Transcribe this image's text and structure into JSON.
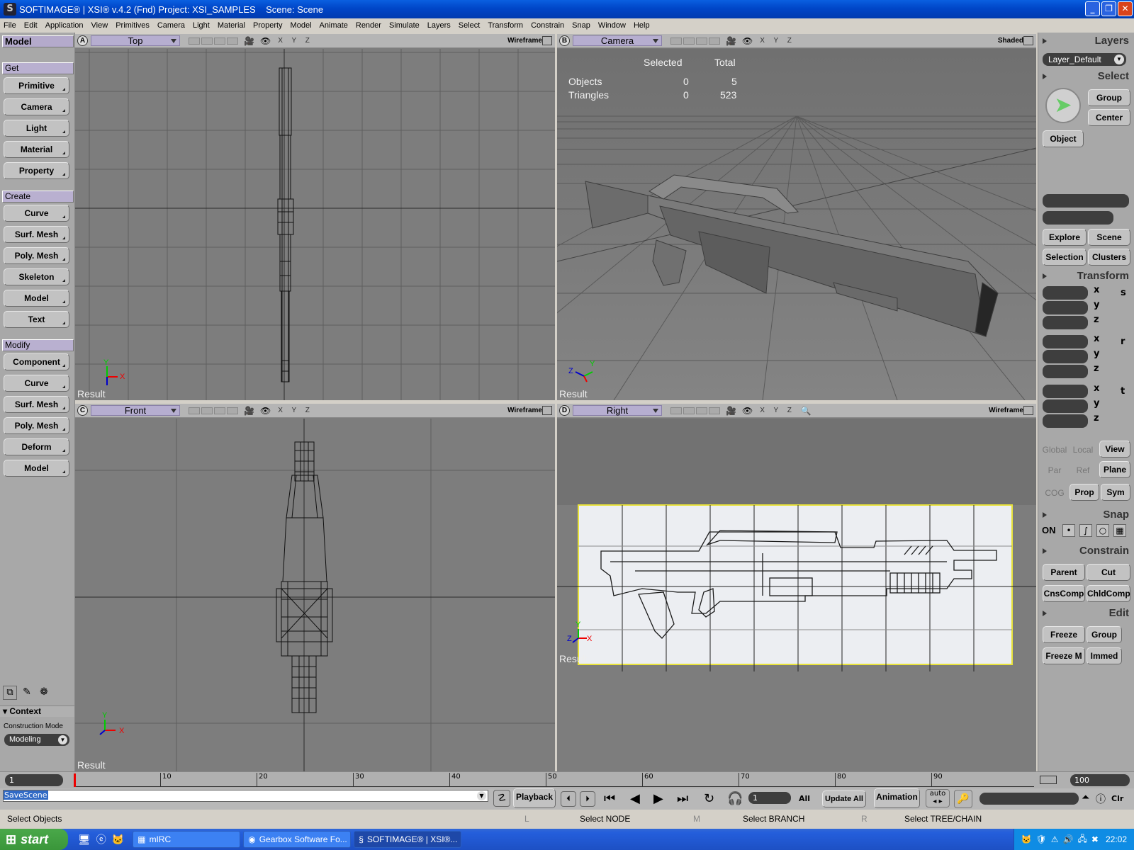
{
  "window": {
    "title": "SOFTIMAGE® | XSI® v.4.2 (Fnd) Project: XSI_SAMPLES    Scene: Scene",
    "logo": "S"
  },
  "menu": [
    "File",
    "Edit",
    "Application",
    "View",
    "Primitives",
    "Camera",
    "Light",
    "Material",
    "Property",
    "Model",
    "Animate",
    "Render",
    "Simulate",
    "Layers",
    "Select",
    "Transform",
    "Constrain",
    "Snap",
    "Window",
    "Help"
  ],
  "left": {
    "title": "Model",
    "get": {
      "label": "Get",
      "items": [
        "Primitive",
        "Camera",
        "Light",
        "Material",
        "Property"
      ]
    },
    "create": {
      "label": "Create",
      "items": [
        "Curve",
        "Surf. Mesh",
        "Poly. Mesh",
        "Skeleton",
        "Model",
        "Text"
      ]
    },
    "modify": {
      "label": "Modify",
      "items": [
        "Component",
        "Curve",
        "Surf. Mesh",
        "Poly. Mesh",
        "Deform",
        "Model"
      ]
    },
    "context": "Context",
    "construction_label": "Construction Mode",
    "construction_value": "Modeling"
  },
  "viewports": {
    "a": {
      "letter": "A",
      "view": "Top",
      "mode": "Wireframe",
      "result": "Result"
    },
    "b": {
      "letter": "B",
      "view": "Camera",
      "mode": "Shaded",
      "result": "Result",
      "stats": {
        "col_selected": "Selected",
        "col_total": "Total",
        "rows": [
          {
            "label": "Objects",
            "selected": "0",
            "total": "5"
          },
          {
            "label": "Triangles",
            "selected": "0",
            "total": "523"
          }
        ]
      }
    },
    "c": {
      "letter": "C",
      "view": "Front",
      "mode": "Wireframe",
      "result": "Result"
    },
    "d": {
      "letter": "D",
      "view": "Right",
      "mode": "Wireframe",
      "result": "Result"
    },
    "xyz": "X Y Z"
  },
  "right": {
    "layers": "Layers",
    "layer_value": "Layer_Default",
    "select": "Select",
    "select_btns": [
      "Group",
      "Center",
      "Object"
    ],
    "explore": "Explore",
    "scene": "Scene",
    "selection": "Selection",
    "clusters": "Clusters",
    "transform": "Transform",
    "axes": [
      "x",
      "y",
      "z"
    ],
    "transform_icons": [
      "s",
      "r",
      "t"
    ],
    "global": "Global",
    "local": "Local",
    "view": "View",
    "par": "Par",
    "ref": "Ref",
    "plane": "Plane",
    "cog": "COG",
    "prop": "Prop",
    "sym": "Sym",
    "snap": "Snap",
    "snap_on": "ON",
    "constrain": "Constrain",
    "parent": "Parent",
    "cut": "Cut",
    "cnscomp": "CnsComp",
    "chldcomp": "ChldComp",
    "edit": "Edit",
    "freeze": "Freeze",
    "group": "Group",
    "freeze_m": "Freeze M",
    "immed": "Immed"
  },
  "timeline": {
    "start": "1",
    "end": "100",
    "ticks": [
      "10",
      "20",
      "30",
      "40",
      "50",
      "60",
      "70",
      "80",
      "90"
    ]
  },
  "command": {
    "value": "SaveScene",
    "playback": "Playback",
    "frame": "1",
    "all": "All",
    "update_all": "Update All",
    "animation": "Animation",
    "auto": "auto",
    "clr": "Clr"
  },
  "status": {
    "left": "Select Objects",
    "l_key": "L",
    "l": "Select NODE",
    "m_key": "M",
    "m": "Select BRANCH",
    "r_key": "R",
    "r": "Select TREE/CHAIN"
  },
  "taskbar": {
    "start": "start",
    "tasks": [
      "mIRC",
      "Gearbox Software Fo...",
      "SOFTIMAGE® | XSI®..."
    ],
    "clock": "22:02"
  }
}
